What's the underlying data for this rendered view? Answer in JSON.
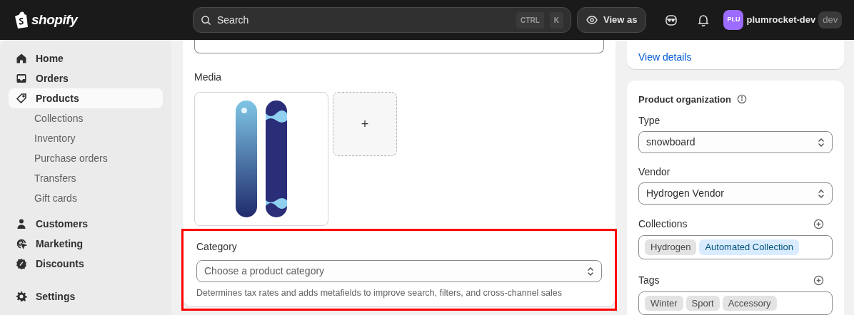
{
  "top_bar": {
    "logo_text": "shopify",
    "search": {
      "placeholder": "Search",
      "shortcut_keys": [
        "CTRL",
        "K"
      ]
    },
    "view_as": "View as",
    "store": {
      "avatar": "PLU",
      "name": "plumrocket-dev",
      "badge": "dev"
    }
  },
  "sidebar": {
    "groups": [
      {
        "items": [
          {
            "label": "Home",
            "selected": false
          },
          {
            "label": "Orders",
            "selected": false
          },
          {
            "label": "Products",
            "selected": true,
            "children": [
              {
                "label": "Collections",
                "selected": false
              },
              {
                "label": "Inventory",
                "selected": false
              },
              {
                "label": "Purchase orders",
                "selected": false
              },
              {
                "label": "Transfers",
                "selected": false
              },
              {
                "label": "Gift cards",
                "selected": false
              }
            ]
          }
        ]
      },
      {
        "items": [
          {
            "label": "Customers",
            "selected": false
          },
          {
            "label": "Marketing",
            "selected": false
          },
          {
            "label": "Discounts",
            "selected": false
          }
        ]
      }
    ],
    "footer_item": {
      "label": "Settings",
      "selected": false
    }
  },
  "main": {
    "media": {
      "label": "Media",
      "add_button": "+"
    },
    "category": {
      "label": "Category",
      "placeholder": "Choose a product category",
      "help": "Determines tax rates and adds metafields to improve search, filters, and cross-channel sales",
      "highlighted": true
    }
  },
  "right": {
    "link": "View details",
    "organization": {
      "title": "Product organization",
      "type": {
        "label": "Type",
        "value": "snowboard"
      },
      "vendor": {
        "label": "Vendor",
        "value": "Hydrogen Vendor"
      },
      "collections": {
        "label": "Collections",
        "tags": [
          {
            "text": "Hydrogen",
            "color": "#e3e3e3"
          },
          {
            "text": "Automated Collection",
            "color": "#d9ecff"
          }
        ]
      },
      "tags": {
        "label": "Tags",
        "tags": [
          {
            "text": "Winter",
            "color": "#e3e3e3"
          },
          {
            "text": "Sport",
            "color": "#e3e3e3"
          },
          {
            "text": "Accessory",
            "color": "#e3e3e3"
          }
        ]
      }
    }
  }
}
